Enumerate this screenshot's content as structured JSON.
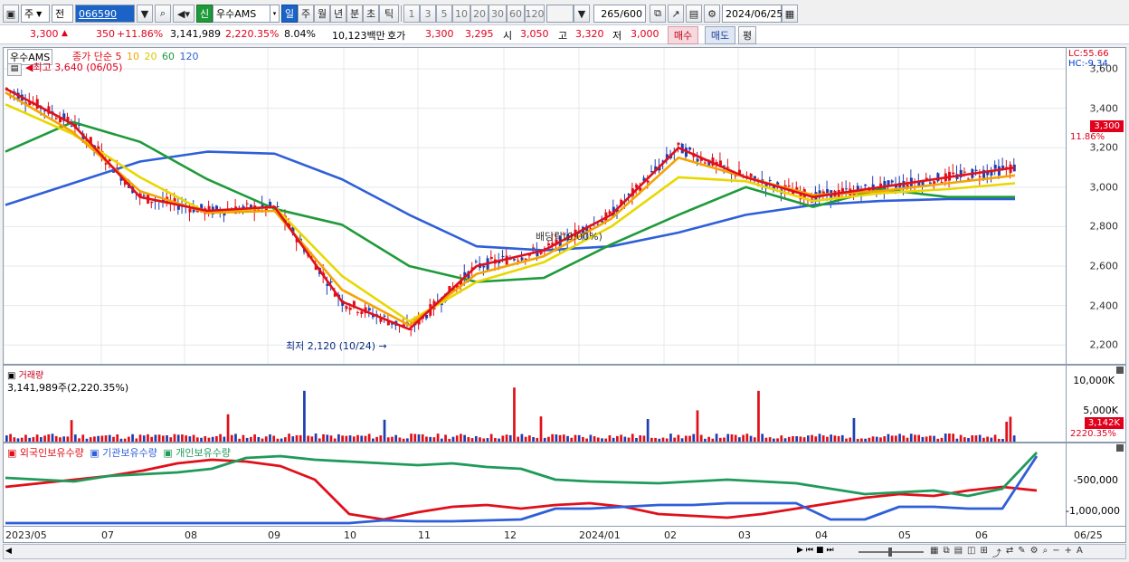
{
  "toolbar": {
    "period": "주",
    "prev": "전",
    "code": "066590",
    "badge": "신",
    "name": "우수AMS",
    "tabs": [
      "일",
      "주",
      "월",
      "년",
      "분",
      "초",
      "틱"
    ],
    "nums": [
      "1",
      "3",
      "5",
      "10",
      "20",
      "30",
      "60",
      "120"
    ],
    "count": "265",
    "total": "/600",
    "date": "2024/06/25"
  },
  "quote": {
    "price": "3,300",
    "change": "350",
    "rate": "+11.86%",
    "volume": "3,141,989",
    "volume_rate": "2,220.35%",
    "turnover": "8.04%",
    "amount": "10,123백만",
    "bid_label": "호가",
    "ask": "3,300",
    "bid": "3,295",
    "open_label": "시",
    "open": "3,050",
    "high_label": "고",
    "high": "3,320",
    "low_label": "저",
    "low": "3,000",
    "buy": "매수",
    "sell": "매도",
    "eval": "평"
  },
  "price_panel": {
    "stock": "우수AMS",
    "ma_label": "종가 단순",
    "ma": [
      {
        "period": "5",
        "color": "#e0101a"
      },
      {
        "period": "10",
        "color": "#f5a300"
      },
      {
        "period": "20",
        "color": "#e8d800"
      },
      {
        "period": "60",
        "color": "#1f9a3a"
      },
      {
        "period": "120",
        "color": "#2f5fd8"
      }
    ],
    "high_note": "최고 3,640 (06/05)",
    "low_note": "최저 2,120 (10/24)",
    "dividend_note": "배당락(0.00%)",
    "lc": "LC:55.66",
    "hc": "HC:-9.34",
    "price_tag": "3,300",
    "rate_tag": "11.86%",
    "y_ticks": [
      "3,600",
      "3,400",
      "3,200",
      "3,000",
      "2,800",
      "2,600",
      "2,400",
      "2,200"
    ]
  },
  "volume_panel": {
    "title": "거래량",
    "value": "3,141,989주(2,220.35%)",
    "y_ticks": [
      "10,000K",
      "5,000K"
    ],
    "tag": "3,142K",
    "rate": "2220.35%"
  },
  "holdings_panel": {
    "series": [
      {
        "name": "외국인보유수량",
        "color": "#e0101a"
      },
      {
        "name": "기관보유수량",
        "color": "#2f5fd8"
      },
      {
        "name": "개인보유수량",
        "color": "#1f9a5a"
      }
    ],
    "y_ticks": [
      "-500,000",
      "-1,000,000"
    ]
  },
  "x_labels": [
    "2023/05",
    "07",
    "08",
    "09",
    "10",
    "11",
    "12",
    "2024/01",
    "02",
    "03",
    "04",
    "05",
    "06",
    "06/25"
  ],
  "chart_data": {
    "type": "line",
    "title": "",
    "xlabel": "",
    "ylabel": "",
    "ylim": [
      2100,
      3660
    ],
    "x": [
      "2023/05",
      "07",
      "08",
      "09",
      "10",
      "11",
      "12",
      "2024/01",
      "02",
      "03",
      "04",
      "05",
      "06",
      "06/25"
    ],
    "series": [
      {
        "name": "5",
        "values": [
          3500,
          3320,
          2950,
          2880,
          2900,
          2420,
          2280,
          2600,
          2680,
          2860,
          3200,
          3050,
          2950,
          3000,
          3050,
          3100
        ]
      },
      {
        "name": "10",
        "values": [
          3480,
          3280,
          2980,
          2870,
          2880,
          2480,
          2300,
          2560,
          2650,
          2840,
          3150,
          3050,
          2960,
          2980,
          3020,
          3060
        ]
      },
      {
        "name": "20",
        "values": [
          3420,
          3270,
          3050,
          2870,
          2900,
          2550,
          2320,
          2520,
          2620,
          2800,
          3050,
          3030,
          2930,
          2970,
          2990,
          3020
        ]
      },
      {
        "name": "60",
        "values": [
          3180,
          3330,
          3230,
          3040,
          2890,
          2810,
          2600,
          2520,
          2540,
          2710,
          2860,
          3000,
          2900,
          2990,
          2950,
          2950
        ]
      },
      {
        "name": "120",
        "values": [
          2910,
          3020,
          3130,
          3180,
          3170,
          3040,
          2860,
          2700,
          2680,
          2700,
          2770,
          2860,
          2910,
          2930,
          2940,
          2940
        ]
      }
    ]
  }
}
